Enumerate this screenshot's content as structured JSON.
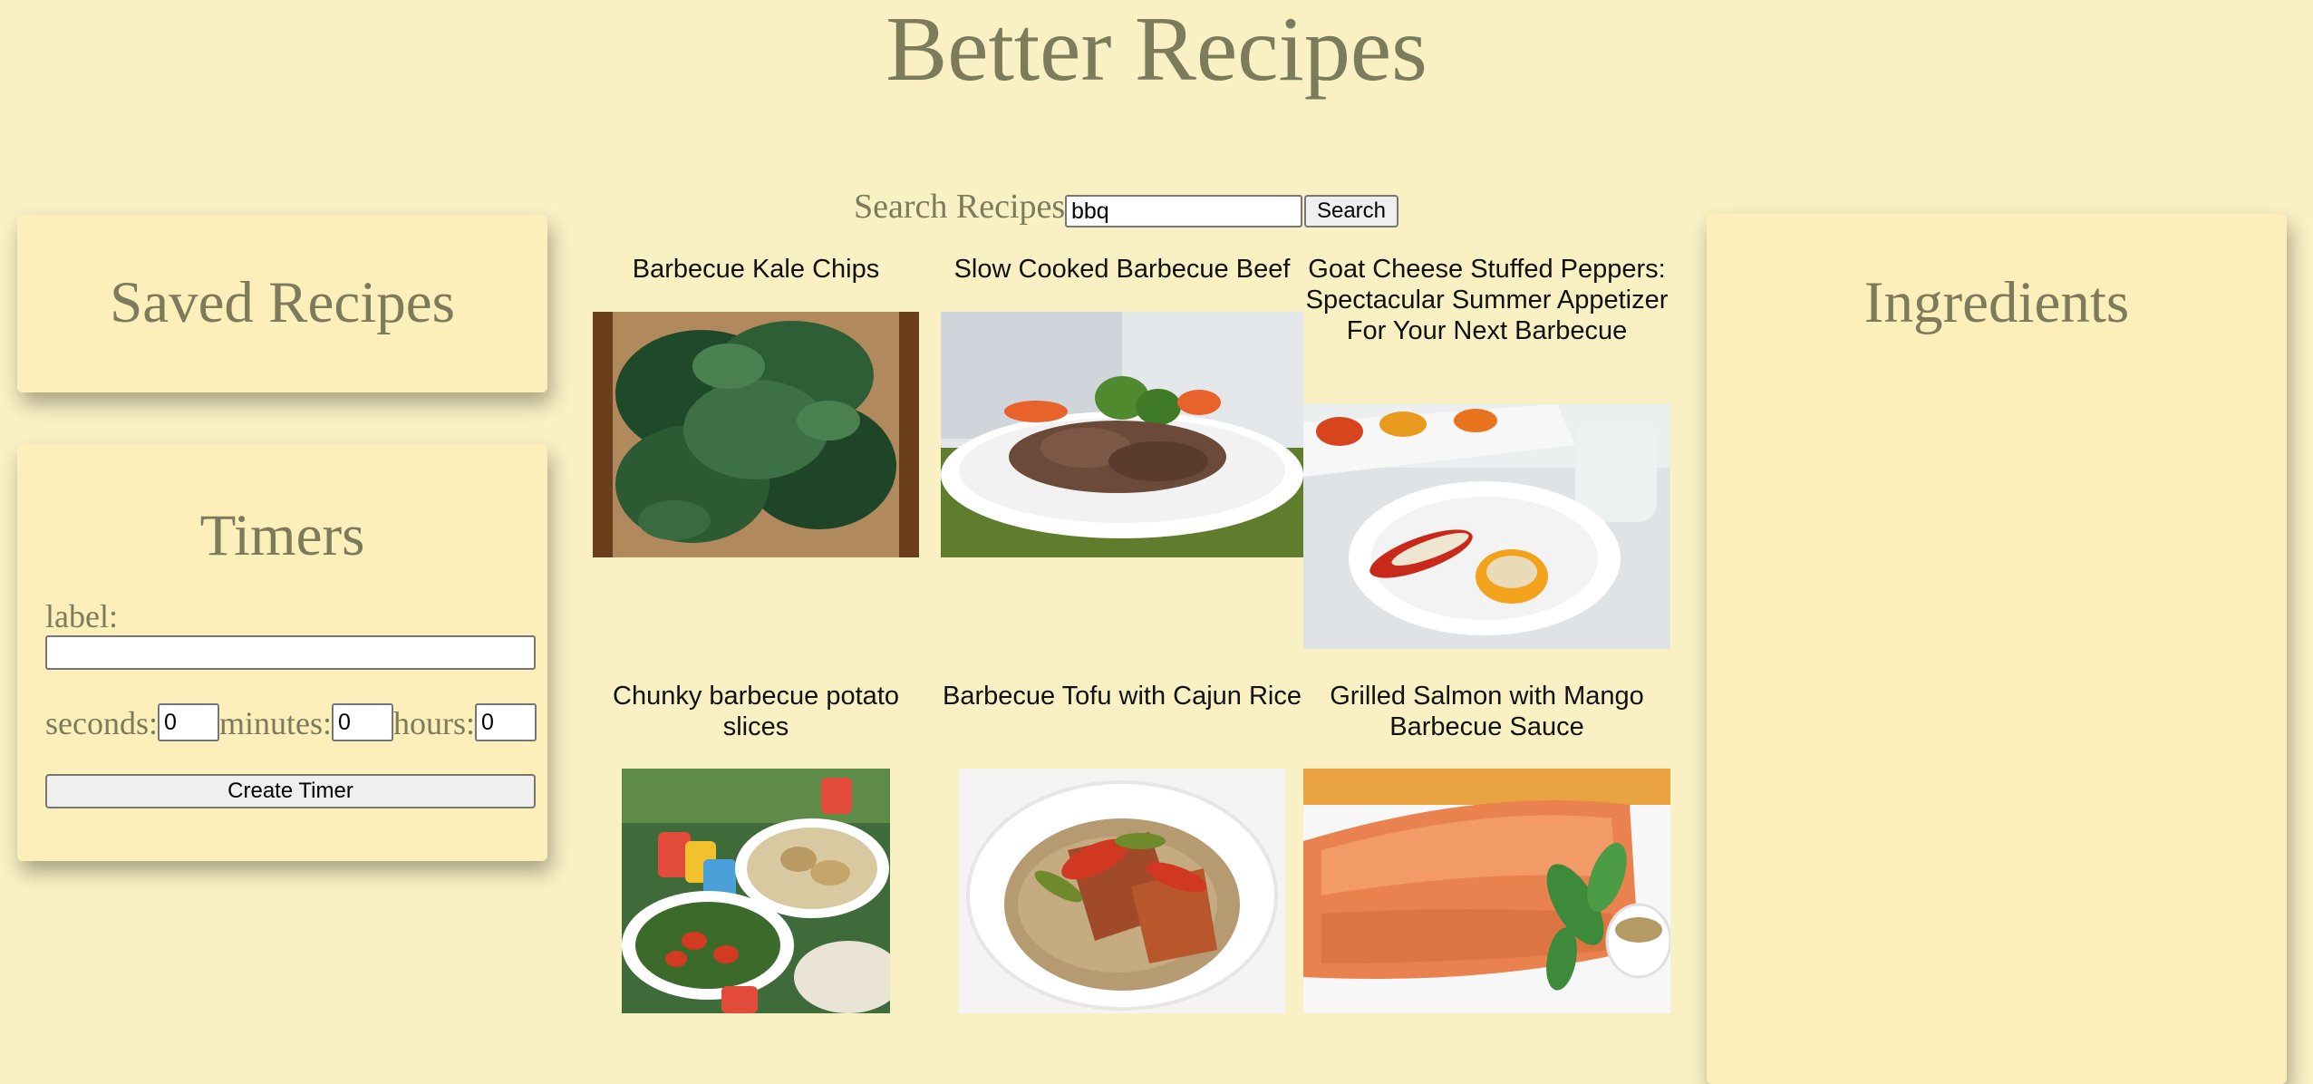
{
  "app": {
    "title": "Better Recipes"
  },
  "search": {
    "label": "Search Recipes:",
    "value": "bbq",
    "button_label": "Search"
  },
  "saved_recipes": {
    "heading": "Saved Recipes"
  },
  "timers": {
    "heading": "Timers",
    "label_text": "label:",
    "label_value": "",
    "seconds_label": "seconds:",
    "seconds_value": "0",
    "minutes_label": "minutes:",
    "minutes_value": "0",
    "hours_label": "hours:",
    "hours_value": "0",
    "create_button_label": "Create Timer"
  },
  "ingredients": {
    "heading": "Ingredients"
  },
  "recipes": [
    {
      "title": "Barbecue Kale Chips",
      "image": "kale-chips-photo"
    },
    {
      "title": "Slow Cooked Barbecue Beef",
      "image": "barbecue-beef-photo"
    },
    {
      "title": "Goat Cheese Stuffed Peppers: Spectacular Summer Appetizer For Your Next Barbecue",
      "image": "stuffed-peppers-photo"
    },
    {
      "title": "Chunky barbecue potato slices",
      "image": "potato-slices-photo"
    },
    {
      "title": "Barbecue Tofu with Cajun Rice",
      "image": "tofu-rice-photo"
    },
    {
      "title": "Grilled Salmon with Mango Barbecue Sauce",
      "image": "grilled-salmon-photo"
    }
  ],
  "colors": {
    "background": "#f9f0c4",
    "card": "#fcefb9",
    "heading_text": "#7c7b5c"
  }
}
